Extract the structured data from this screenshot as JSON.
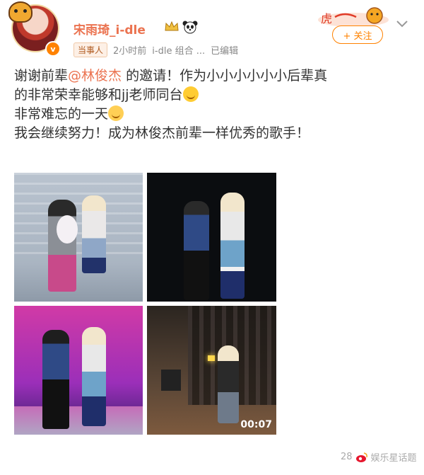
{
  "header": {
    "username": "宋雨琦_i-dle",
    "tag": "当事人",
    "time": "2小时前",
    "source": "i-dle 组合 ...",
    "edited": "已编辑",
    "follow_label": "+ 关注"
  },
  "post": {
    "line1_prefix": "谢谢前辈",
    "mention": "@林俊杰",
    "line1_suffix": "的邀请！作为小小小小小小后辈真",
    "line2": "的非常荣幸能够和jj老师同台",
    "line3": "非常难忘的一天",
    "line4": "我会继续努力！成为林俊杰前辈一样优秀的歌手！"
  },
  "media": {
    "video_duration": "00:07"
  },
  "footer": {
    "count": "28",
    "watermark": "娱乐星话题"
  },
  "colors": {
    "accent": "#eb7350",
    "follow": "#ff8200"
  }
}
